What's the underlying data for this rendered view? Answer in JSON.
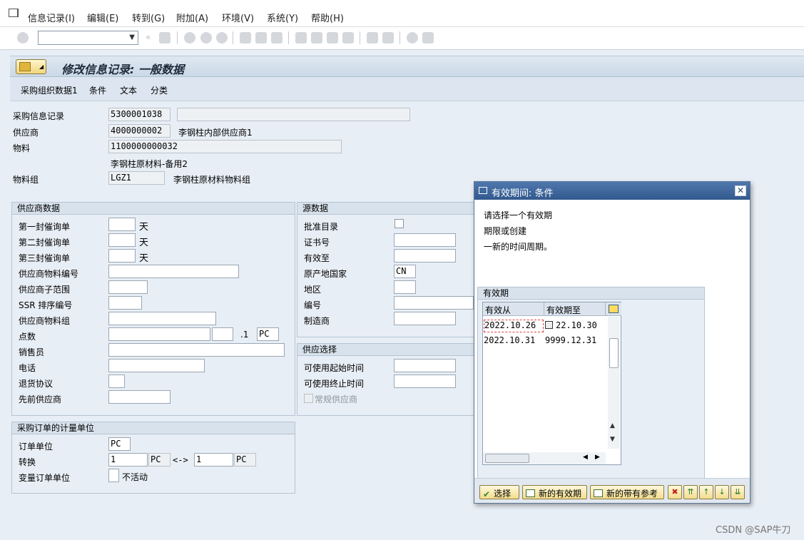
{
  "menu": [
    "信息记录(I)",
    "编辑(E)",
    "转到(G)",
    "附加(A)",
    "环境(V)",
    "系统(Y)",
    "帮助(H)"
  ],
  "title": "修改信息记录: 一般数据",
  "app_toolbar": [
    "采购组织数据1",
    "条件",
    "文本",
    "分类"
  ],
  "header": {
    "info_record_label": "采购信息记录",
    "info_record_value": "5300001038",
    "vendor_label": "供应商",
    "vendor_value": "4000000002",
    "vendor_name": "李钢柱内部供应商1",
    "material_label": "物料",
    "material_value": "1100000000032",
    "material_desc": "李钢柱原材料-备用2",
    "matgroup_label": "物料组",
    "matgroup_value": "LGZ1",
    "matgroup_desc": "李钢柱原材料物料组"
  },
  "vendor_data": {
    "title": "供应商数据",
    "reminder1": "第一封催询单",
    "reminder2": "第二封催询单",
    "reminder3": "第三封催询单",
    "days": "天",
    "vendor_mat_no": "供应商物料编号",
    "vendor_subrange": "供应商子范围",
    "ssr_sort": "SSR 排序编号",
    "vendor_mat_group": "供应商物料组",
    "points": "点数",
    "points_sep": ".1",
    "points_unit": "PC",
    "salesperson": "销售员",
    "phone": "电话",
    "return_agreement": "退货协议",
    "prior_vendor": "先前供应商"
  },
  "source_data": {
    "title": "源数据",
    "approved_list": "批准目录",
    "cert_no": "证书号",
    "valid_to": "有效至",
    "country": "原产地国家",
    "country_value": "CN",
    "region": "地区",
    "number": "编号",
    "manufacturer": "制造商"
  },
  "supply_option": {
    "title": "供应选择",
    "avail_from": "可使用起始时间",
    "avail_to": "可使用终止时间",
    "regular_vendor": "常规供应商"
  },
  "order_unit": {
    "title": "采购订单的计量单位",
    "order_unit_label": "订单单位",
    "order_unit_value": "PC",
    "conversion": "转换",
    "conv_num": "1",
    "conv_unit1": "PC",
    "conv_arrow": "<->",
    "conv_den": "1",
    "conv_unit2": "PC",
    "variable_unit": "变量订单单位",
    "inactive": "不活动"
  },
  "dialog": {
    "title": "有效期间: 条件",
    "line1": "请选择一个有效期",
    "line2": "期限或创建",
    "line3": "一新的时间周期。",
    "group_title": "有效期",
    "col_from": "有效从",
    "col_to": "有效期至",
    "rows": [
      {
        "from": "2022.10.26",
        "to": "22.10.30"
      },
      {
        "from": "2022.10.31",
        "to": "9999.12.31"
      }
    ],
    "btn_select": "选择",
    "btn_new_validity": "新的有效期",
    "btn_new_ref": "新的带有参考"
  },
  "watermark": "CSDN @SAP牛刀"
}
